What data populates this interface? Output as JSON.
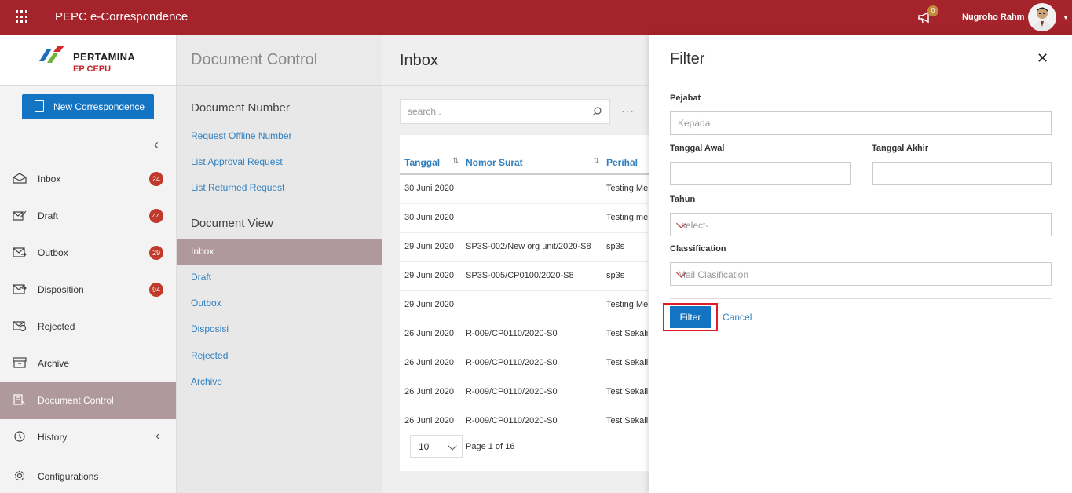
{
  "topbar": {
    "app_title": "PEPC e-Correspondence",
    "notification_count": "0",
    "username": "Nugroho Rahm"
  },
  "logo": {
    "line1": "PERTAMINA",
    "line2": "EP CEPU"
  },
  "new_button": "New Correspondence",
  "nav": {
    "items": [
      {
        "label": "Inbox",
        "badge": "24"
      },
      {
        "label": "Draft",
        "badge": "44"
      },
      {
        "label": "Outbox",
        "badge": "29"
      },
      {
        "label": "Disposition",
        "badge": "94"
      },
      {
        "label": "Rejected"
      },
      {
        "label": "Archive"
      },
      {
        "label": "Document Control"
      },
      {
        "label": "History"
      },
      {
        "label": "Configurations"
      }
    ]
  },
  "sidecol": {
    "title": "Document Control",
    "section1": "Document Number",
    "section1_links": [
      "Request Offline Number",
      "List Approval Request",
      "List Returned Request"
    ],
    "section2": "Document View",
    "section2_links": [
      "Inbox",
      "Draft",
      "Outbox",
      "Disposisi",
      "Rejected",
      "Archive"
    ]
  },
  "main": {
    "title": "Inbox",
    "search_placeholder": "search..",
    "columns": [
      "Tanggal",
      "Nomor Surat",
      "Perihal"
    ],
    "rows": [
      {
        "tanggal": "30 Juni 2020",
        "nomor": "",
        "perihal": "Testing Me"
      },
      {
        "tanggal": "30 Juni 2020",
        "nomor": "",
        "perihal": "Testing me"
      },
      {
        "tanggal": "29 Juni 2020",
        "nomor": "SP3S-002/New org unit/2020-S8",
        "perihal": "sp3s"
      },
      {
        "tanggal": "29 Juni 2020",
        "nomor": "SP3S-005/CP0100/2020-S8",
        "perihal": "sp3s"
      },
      {
        "tanggal": "29 Juni 2020",
        "nomor": "",
        "perihal": "Testing Me"
      },
      {
        "tanggal": "26 Juni 2020",
        "nomor": "R-009/CP0110/2020-S0",
        "perihal": "Test Sekali"
      },
      {
        "tanggal": "26 Juni 2020",
        "nomor": "R-009/CP0110/2020-S0",
        "perihal": "Test Sekali"
      },
      {
        "tanggal": "26 Juni 2020",
        "nomor": "R-009/CP0110/2020-S0",
        "perihal": "Test Sekali"
      },
      {
        "tanggal": "26 Juni 2020",
        "nomor": "R-009/CP0110/2020-S0",
        "perihal": "Test Sekali"
      }
    ],
    "page_size": "10",
    "page_info": "Page 1 of 16"
  },
  "filter": {
    "title": "Filter",
    "pejabat_label": "Pejabat",
    "pejabat_placeholder": "Kepada",
    "tanggal_awal_label": "Tanggal Awal",
    "tanggal_akhir_label": "Tanggal Akhir",
    "tahun_label": "Tahun",
    "tahun_value": "-select-",
    "classification_label": "Classification",
    "classification_value": "Mail Clasification",
    "filter_button": "Filter",
    "cancel_button": "Cancel"
  },
  "colors": {
    "topbar": "#a5232a",
    "primary_button": "#1474c4",
    "active_nav": "#b0999c",
    "badge": "#c0392b",
    "link": "#2f7fbf",
    "highlight_box": "#e01b24"
  }
}
